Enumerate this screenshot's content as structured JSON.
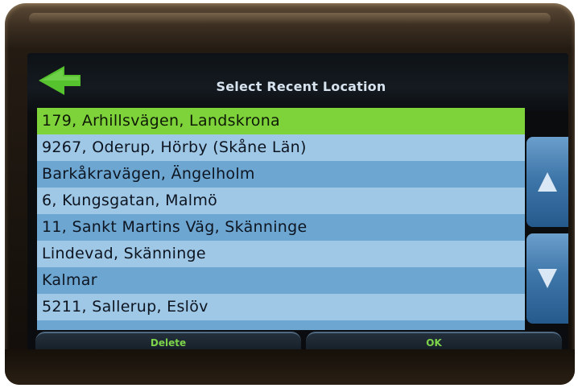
{
  "header": {
    "title": "Select Recent Location",
    "back_icon": "back-arrow-icon",
    "accent": "#55c22e"
  },
  "list": {
    "selected_index": 0,
    "items": [
      "179, Arhillsvägen, Landskrona",
      "9267, Oderup, Hörby (Skåne Län)",
      "Barkåkravägen, Ängelholm",
      "6, Kungsgatan, Malmö",
      "11, Sankt Martins Väg, Skänninge",
      "Lindevad, Skänninge",
      "Kalmar",
      "5211, Sallerup, Eslöv"
    ],
    "selected_color": "#7ed23a",
    "row_colors": [
      "#9fc7e6",
      "#6ea6d2"
    ]
  },
  "scroll": {
    "up_icon": "scroll-up-arrow-icon",
    "down_icon": "scroll-down-arrow-icon"
  },
  "footer": {
    "delete_label": "Delete",
    "ok_label": "OK",
    "label_color": "#7dd34a"
  }
}
